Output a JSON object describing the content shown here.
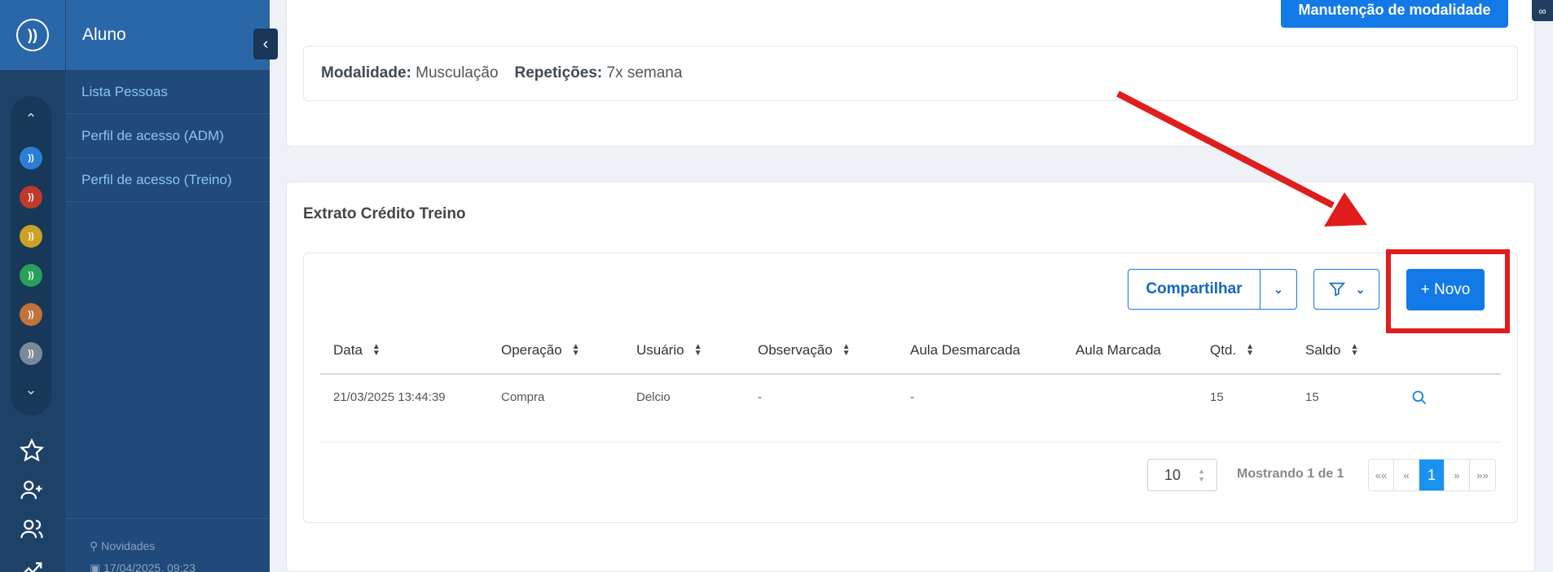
{
  "sidebar": {
    "header": "Aluno",
    "items": [
      {
        "label": "Lista Pessoas"
      },
      {
        "label": "Perfil de acesso (ADM)"
      },
      {
        "label": "Perfil de acesso (Treino)"
      }
    ],
    "footer": {
      "news": "Novidades",
      "datetime": "17/04/2025, 09:23"
    }
  },
  "rail": {
    "app_colors": [
      "#2a7fd4",
      "#c0392b",
      "#c9a227",
      "#27a05a",
      "#c0733a",
      "#7a8a99"
    ]
  },
  "top_card": {
    "button": "Manutenção de modalidade",
    "modalidade_label": "Modalidade:",
    "modalidade_value": "Musculação",
    "repeticoes_label": "Repetições:",
    "repeticoes_value": "7x semana"
  },
  "extrato": {
    "title": "Extrato Crédito Treino",
    "share_button": "Compartilhar",
    "new_button": "+ Novo",
    "columns": [
      "Data",
      "Operação",
      "Usuário",
      "Observação",
      "Aula Desmarcada",
      "Aula Marcada",
      "Qtd.",
      "Saldo"
    ],
    "rows": [
      {
        "data": "21/03/2025 13:44:39",
        "operacao": "Compra",
        "usuario": "Delcio",
        "observacao": "-",
        "aula_desmarcada": "-",
        "aula_marcada": "",
        "qtd": "15",
        "saldo": "15"
      }
    ],
    "page_size": "10",
    "showing": "Mostrando 1 de 1",
    "pager": {
      "first": "««",
      "prev": "«",
      "current": "1",
      "next": "»",
      "last": "»»"
    }
  },
  "colors": {
    "primary": "#1379e6",
    "highlight": "#e01c1c",
    "sidebar": "#1f4a7a"
  }
}
